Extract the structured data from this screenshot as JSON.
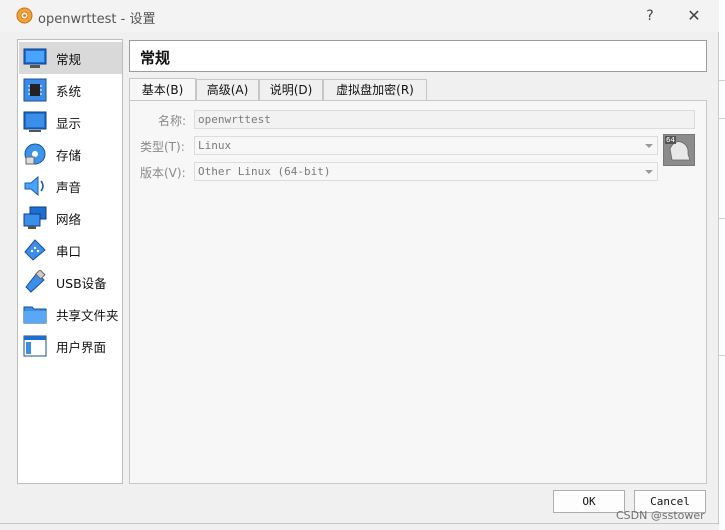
{
  "window": {
    "title": "openwrttest - 设置",
    "help_label": "?",
    "close_label": "✕"
  },
  "sidebar": {
    "items": [
      {
        "label": "常规",
        "icon": "general-monitor-icon",
        "selected": true
      },
      {
        "label": "系统",
        "icon": "system-chip-icon"
      },
      {
        "label": "显示",
        "icon": "display-monitor-icon"
      },
      {
        "label": "存储",
        "icon": "storage-disk-icon"
      },
      {
        "label": "声音",
        "icon": "speaker-icon"
      },
      {
        "label": "网络",
        "icon": "network-icon"
      },
      {
        "label": "串口",
        "icon": "serial-port-icon"
      },
      {
        "label": "USB设备",
        "icon": "usb-icon"
      },
      {
        "label": "共享文件夹",
        "icon": "shared-folder-icon"
      },
      {
        "label": "用户界面",
        "icon": "user-interface-icon"
      }
    ]
  },
  "header": {
    "title": "常规"
  },
  "tabs": [
    {
      "label": "基本(B)",
      "active": true
    },
    {
      "label": "高级(A)"
    },
    {
      "label": "说明(D)"
    },
    {
      "label": "虚拟盘加密(R)"
    }
  ],
  "form": {
    "name_label": "名称:",
    "name_value": "openwrttest",
    "type_label": "类型(T):",
    "type_value": "Linux",
    "version_label": "版本(V):",
    "version_value": "Other Linux (64-bit)",
    "os_icon": "linux-64-icon",
    "os_badge": "64"
  },
  "buttons": {
    "ok_label": "OK",
    "cancel_label": "Cancel"
  },
  "watermark": "CSDN @sstower"
}
